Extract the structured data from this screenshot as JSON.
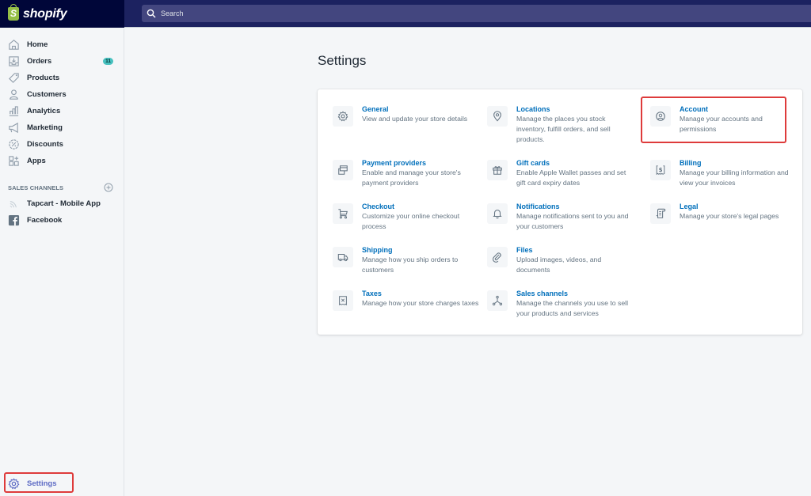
{
  "brand": {
    "name": "shopify",
    "logo_letter": "S"
  },
  "search": {
    "placeholder": "Search"
  },
  "sidebar": {
    "items": [
      {
        "label": "Home",
        "icon": "home-icon"
      },
      {
        "label": "Orders",
        "icon": "orders-icon",
        "badge": "11"
      },
      {
        "label": "Products",
        "icon": "tag-icon"
      },
      {
        "label": "Customers",
        "icon": "person-icon"
      },
      {
        "label": "Analytics",
        "icon": "bar-chart-icon"
      },
      {
        "label": "Marketing",
        "icon": "megaphone-icon"
      },
      {
        "label": "Discounts",
        "icon": "discount-icon"
      },
      {
        "label": "Apps",
        "icon": "apps-icon"
      }
    ],
    "sales_channels_title": "SALES CHANNELS",
    "channels": [
      {
        "label": "Tapcart - Mobile App",
        "icon": "signal-icon"
      },
      {
        "label": "Facebook",
        "icon": "facebook-icon"
      }
    ],
    "settings_label": "Settings"
  },
  "main": {
    "title": "Settings",
    "settings": [
      {
        "title": "General",
        "desc": "View and update your store details",
        "icon": "gear-icon"
      },
      {
        "title": "Locations",
        "desc": "Manage the places you stock inventory, fulfill orders, and sell products.",
        "icon": "location-pin-icon"
      },
      {
        "title": "Account",
        "desc": "Manage your accounts and permissions",
        "icon": "account-icon"
      },
      {
        "title": "Payment providers",
        "desc": "Enable and manage your store's payment providers",
        "icon": "payment-icon"
      },
      {
        "title": "Gift cards",
        "desc": "Enable Apple Wallet passes and set gift card expiry dates",
        "icon": "gift-icon"
      },
      {
        "title": "Billing",
        "desc": "Manage your billing information and view your invoices",
        "icon": "billing-icon"
      },
      {
        "title": "Checkout",
        "desc": "Customize your online checkout process",
        "icon": "cart-icon"
      },
      {
        "title": "Notifications",
        "desc": "Manage notifications sent to you and your customers",
        "icon": "bell-icon"
      },
      {
        "title": "Legal",
        "desc": "Manage your store's legal pages",
        "icon": "legal-icon"
      },
      {
        "title": "Shipping",
        "desc": "Manage how you ship orders to customers",
        "icon": "truck-icon"
      },
      {
        "title": "Files",
        "desc": "Upload images, videos, and documents",
        "icon": "paperclip-icon"
      },
      {
        "title": "Taxes",
        "desc": "Manage how your store charges taxes",
        "icon": "tax-icon"
      },
      {
        "title": "Sales channels",
        "desc": "Manage the channels you use to sell your products and services",
        "icon": "channels-icon"
      }
    ]
  },
  "colors": {
    "topbar": "#1c2260",
    "brand_bg": "#000639",
    "link": "#006fbb",
    "badge": "#47c1bf",
    "highlight": "#de3b3b",
    "active_nav": "#5c6ac4"
  }
}
